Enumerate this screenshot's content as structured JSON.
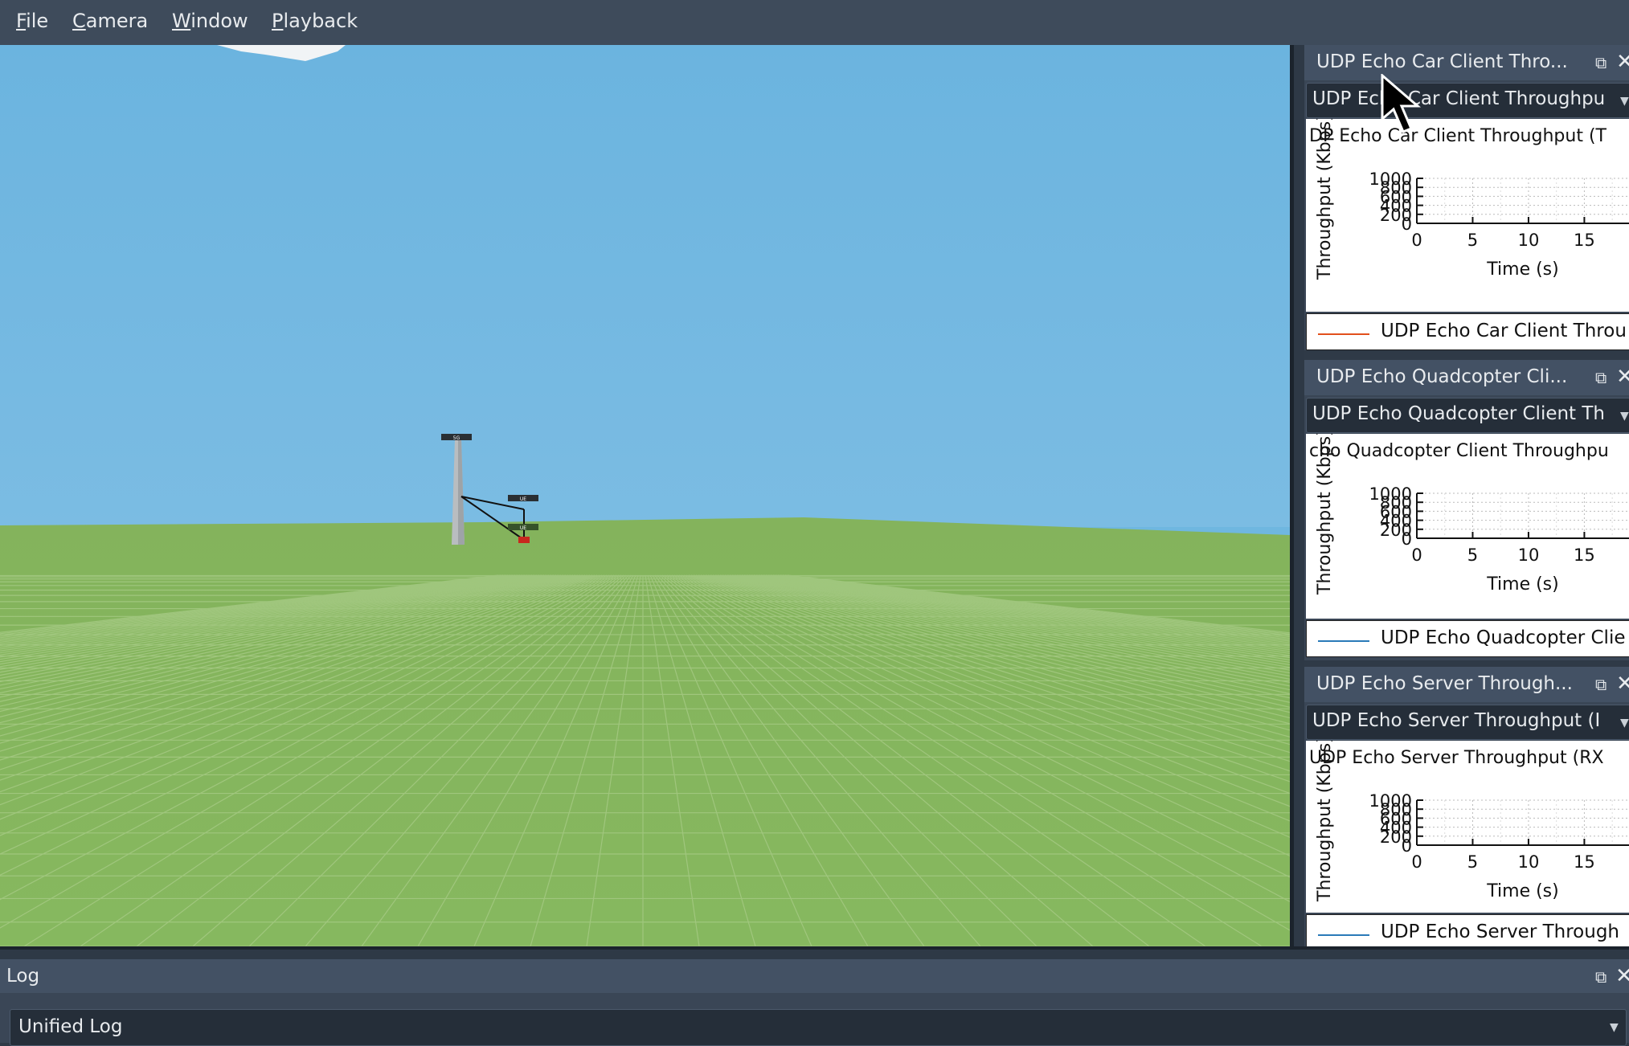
{
  "menu": {
    "items": [
      {
        "mnemonic": "F",
        "rest": "ile"
      },
      {
        "mnemonic": "C",
        "rest": "amera"
      },
      {
        "mnemonic": "W",
        "rest": "indow"
      },
      {
        "mnemonic": "P",
        "rest": "layback"
      }
    ]
  },
  "scene": {
    "sky_color": "#6fb7e0",
    "ground_color": "#84b35c",
    "tower_label": "5G",
    "node_label_1": "UE",
    "node_label_2": "UE"
  },
  "docks": [
    {
      "title": "UDP Echo Car Client Thro...",
      "combo_value": "UDP Echo Car Client Throughpu",
      "plot_title": "DP Echo Car Client Throughput (T",
      "ylabel": "Throughput (Kbps)",
      "xlabel": "Time (s)",
      "legend": "UDP Echo Car Client Throu",
      "legend_color": "#e2501c"
    },
    {
      "title": "UDP Echo Quadcopter Cli...",
      "combo_value": "UDP Echo Quadcopter Client Th",
      "plot_title": "cho Quadcopter Client Throughpu",
      "ylabel": "Throughput (Kbps)",
      "xlabel": "Time (s)",
      "legend": "UDP Echo Quadcopter Clie",
      "legend_color": "#2a7ab8"
    },
    {
      "title": "UDP Echo Server Through...",
      "combo_value": "UDP Echo Server Throughput (I",
      "plot_title": "UDP Echo Server Throughput (RX",
      "ylabel": "Throughput (Kbps)",
      "xlabel": "Time (s)",
      "legend": "UDP Echo Server Through",
      "legend_color": "#2a7ab8"
    }
  ],
  "chart_data": [
    {
      "type": "line",
      "title": "DP Echo Car Client Throughput (T",
      "xlabel": "Time (s)",
      "ylabel": "Throughput (Kbps)",
      "xticks": [
        0,
        5,
        10,
        15
      ],
      "yticks": [
        0,
        200,
        400,
        600,
        800,
        1000
      ],
      "xlim": [
        0,
        19
      ],
      "ylim": [
        0,
        1000
      ],
      "grid": true,
      "series": [
        {
          "name": "UDP Echo Car Client Throu",
          "x": [],
          "y": []
        }
      ]
    },
    {
      "type": "line",
      "title": "cho Quadcopter Client Throughpu",
      "xlabel": "Time (s)",
      "ylabel": "Throughput (Kbps)",
      "xticks": [
        0,
        5,
        10,
        15
      ],
      "yticks": [
        0,
        200,
        400,
        600,
        800,
        1000
      ],
      "xlim": [
        0,
        19
      ],
      "ylim": [
        0,
        1000
      ],
      "grid": true,
      "series": [
        {
          "name": "UDP Echo Quadcopter Clie",
          "x": [],
          "y": []
        }
      ]
    },
    {
      "type": "line",
      "title": "UDP Echo Server Throughput (RX",
      "xlabel": "Time (s)",
      "ylabel": "Throughput (Kbps)",
      "xticks": [
        0,
        5,
        10,
        15
      ],
      "yticks": [
        0,
        200,
        400,
        600,
        800,
        1000
      ],
      "xlim": [
        0,
        19
      ],
      "ylim": [
        0,
        1000
      ],
      "grid": true,
      "series": [
        {
          "name": "UDP Echo Server Through",
          "x": [],
          "y": []
        }
      ]
    }
  ],
  "log": {
    "title": "Log",
    "combo_value": "Unified Log"
  },
  "icons": {
    "float": "float-icon",
    "close": "close-icon",
    "dropdown": "chevron-down-icon"
  }
}
